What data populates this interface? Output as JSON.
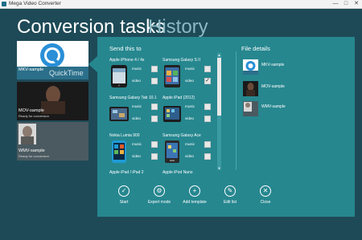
{
  "window": {
    "title": "Mega Video Converter",
    "min_glyph": "—",
    "max_glyph": "□",
    "close_glyph": "✕"
  },
  "tabs": {
    "active": "Conversion tasks",
    "inactive": "History"
  },
  "queue": [
    {
      "name": "MKV-sample",
      "status": "",
      "thumb_text": "QuickTime"
    },
    {
      "name": "MOV-sample",
      "status": "Ready for conversion"
    },
    {
      "name": "WMV-sample",
      "status": "Ready for conversion"
    }
  ],
  "dialog": {
    "send_title": "Send this to",
    "details_title": "File details",
    "option_music": "music",
    "option_video": "video",
    "check_glyph": "✓",
    "devices": [
      {
        "name": "Apple iPhone 4 / 4s",
        "music": false,
        "video": false
      },
      {
        "name": "Samsung Galaxy S II",
        "music": false,
        "video": true
      },
      {
        "name": "Samsung Galaxy Tab 10.1",
        "music": false,
        "video": false
      },
      {
        "name": "Apple iPad (2012)",
        "music": false,
        "video": false
      },
      {
        "name": "Nokia Lumia 900",
        "music": false,
        "video": false
      },
      {
        "name": "Samsung Galaxy Ace",
        "music": false,
        "video": false
      },
      {
        "name": "Apple iPad / iPad 2",
        "music": false,
        "video": false
      },
      {
        "name": "Apple iPod Nano",
        "music": false,
        "video": false
      }
    ],
    "file_details": [
      {
        "name": "MKV-sample"
      },
      {
        "name": "MOV-sample"
      },
      {
        "name": "WMV-sample"
      }
    ],
    "scroll_up": "▲",
    "scroll_down": "▼",
    "actions": [
      {
        "label": "Start",
        "icon": "checkmark-icon",
        "glyph": "✓"
      },
      {
        "label": "Expert mode",
        "icon": "expert-mode-icon",
        "glyph": "⚙"
      },
      {
        "label": "Add template",
        "icon": "plus-icon",
        "glyph": "+"
      },
      {
        "label": "Edit list",
        "icon": "edit-list-icon",
        "glyph": "✎"
      },
      {
        "label": "Close",
        "icon": "close-icon",
        "glyph": "✕"
      }
    ]
  },
  "colors": {
    "background": "#1e4a57",
    "dialog": "#26878f",
    "inactive_tab": "#8bb9c4"
  }
}
